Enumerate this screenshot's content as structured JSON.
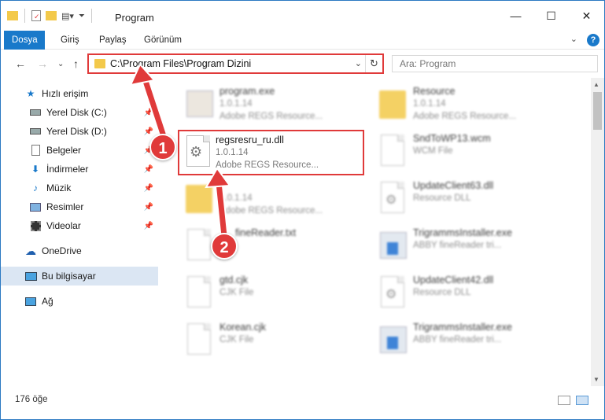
{
  "window": {
    "title": "Program"
  },
  "ribbon": {
    "tabs": [
      "Dosya",
      "Giriş",
      "Paylaş",
      "Görünüm"
    ],
    "help": "?"
  },
  "nav": {
    "address": "C:\\Program Files\\Program Dizini",
    "search_placeholder": "Ara: Program"
  },
  "sidebar": {
    "quick_access": "Hızlı erişim",
    "items": [
      "Yerel Disk (C:)",
      "Yerel Disk (D:)",
      "Belgeler",
      "İndirmeler",
      "Müzik",
      "Resimler",
      "Videolar"
    ],
    "onedrive": "OneDrive",
    "this_pc": "Bu bilgisayar",
    "network": "Ağ"
  },
  "files": {
    "col1": [
      {
        "name": "program.exe",
        "meta1": "1.0.1.14",
        "meta2": "Adobe REGS Resource..."
      },
      {
        "name": "regsresru_ru.dll",
        "meta1": "1.0.1.14",
        "meta2": "Adobe REGS Resource..."
      },
      {
        "name": "",
        "meta1": "1.0.1.14",
        "meta2": "Adobe REGS Resource..."
      },
      {
        "name": "fineReader.txt",
        "meta1": "",
        "meta2": ""
      },
      {
        "name": "gtd.cjk",
        "meta1": "CJK File",
        "meta2": ""
      },
      {
        "name": "Korean.cjk",
        "meta1": "CJK File",
        "meta2": ""
      }
    ],
    "col2": [
      {
        "name": "Resource",
        "meta1": "1.0.1.14",
        "meta2": "Adobe REGS Resource..."
      },
      {
        "name": "SndToWP13.wcm",
        "meta1": "WCM File",
        "meta2": ""
      },
      {
        "name": "UpdateClient63.dll",
        "meta1": "Resource DLL",
        "meta2": ""
      },
      {
        "name": "TrigrammsInstaller.exe",
        "meta1": "ABBY fineReader tri...",
        "meta2": ""
      },
      {
        "name": "UpdateClient42.dll",
        "meta1": "Resource DLL",
        "meta2": ""
      },
      {
        "name": "TrigrammsInstaller.exe",
        "meta1": "ABBY fineReader tri...",
        "meta2": ""
      }
    ]
  },
  "status": {
    "count": "176 öğe"
  },
  "callouts": [
    "1",
    "2"
  ],
  "colors": {
    "accent": "#1979ca",
    "callout": "#e03a3a",
    "folder": "#f3c94a"
  }
}
